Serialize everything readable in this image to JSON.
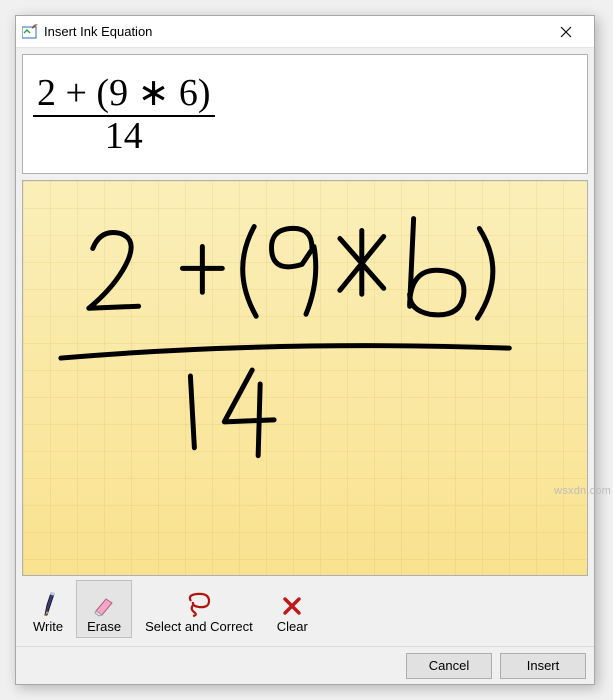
{
  "window": {
    "title": "Insert Ink Equation"
  },
  "recognizedEquation": {
    "numerator": "2 + (9 ∗ 6)",
    "denominator": "14"
  },
  "inkCanvas": {
    "handwrittenExpression": "2 + ( 9 * 6 ) / 14"
  },
  "toolbar": {
    "write": "Write",
    "erase": "Erase",
    "selectCorrect": "Select and Correct",
    "clear": "Clear",
    "activeTool": "erase"
  },
  "footer": {
    "cancel": "Cancel",
    "insert": "Insert"
  },
  "watermark": "wsxdn.com"
}
